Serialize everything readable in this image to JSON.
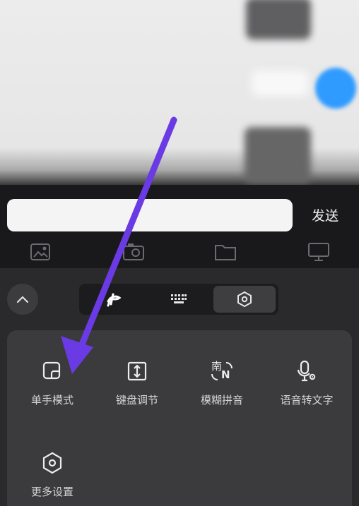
{
  "composer": {
    "message_value": "",
    "send_label": "发送",
    "tools": [
      "image-icon",
      "camera-icon",
      "folder-icon",
      "monitor-icon"
    ]
  },
  "keyboard": {
    "collapse_icon": "chevron-up-icon",
    "modes": [
      {
        "icon": "pinyin-logo-icon",
        "active": false
      },
      {
        "icon": "keyboard-icon",
        "active": false
      },
      {
        "icon": "hexagon-settings-icon",
        "active": true
      }
    ],
    "functions": [
      {
        "label": "单手模式",
        "icon": "one-hand-icon"
      },
      {
        "label": "键盘调节",
        "icon": "resize-icon"
      },
      {
        "label": "模糊拼音",
        "icon": "fuzzy-pinyin-icon",
        "icon_text": "南",
        "icon_text2": "N"
      },
      {
        "label": "语音转文字",
        "icon": "mic-settings-icon"
      },
      {
        "label": "更多设置",
        "icon": "hexagon-settings-icon"
      }
    ]
  },
  "overlay": {
    "arrow_color": "#6a3be4",
    "arrow_target": "单手模式"
  }
}
